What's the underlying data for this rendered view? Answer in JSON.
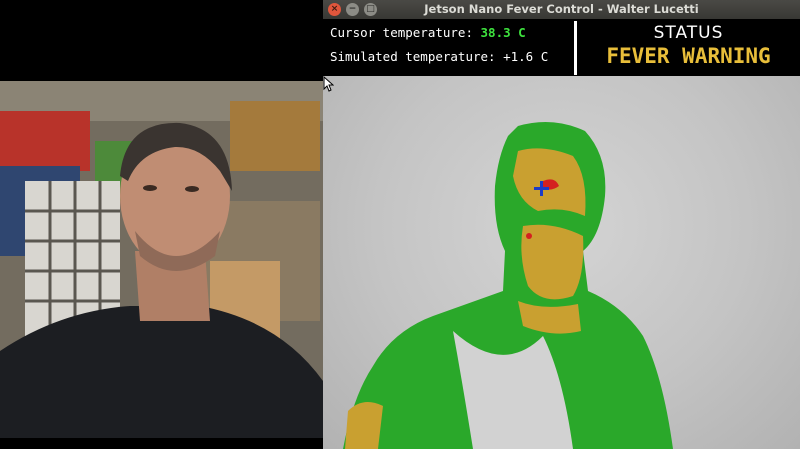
{
  "window": {
    "title": "Jetson Nano Fever Control - Walter Lucetti",
    "close_glyph": "×",
    "minimize_glyph": "−",
    "maximize_glyph": "□"
  },
  "readouts": {
    "cursor_label": "Cursor temperature: ",
    "cursor_value": "38.3 C",
    "simulated_label": "Simulated temperature: ",
    "simulated_value": "+1.6 C"
  },
  "status": {
    "label": "STATUS",
    "value": "FEVER WARNING"
  },
  "colors": {
    "cursor_value": "#3ee33e",
    "status_value": "#e8be3a",
    "thermal_green": "#2aa82a",
    "thermal_orange": "#c9a030",
    "thermal_red": "#d42020",
    "crosshair": "#1a3cc8"
  },
  "icons": {
    "crosshair": "crosshair-icon",
    "pointer": "mouse-pointer-icon"
  }
}
